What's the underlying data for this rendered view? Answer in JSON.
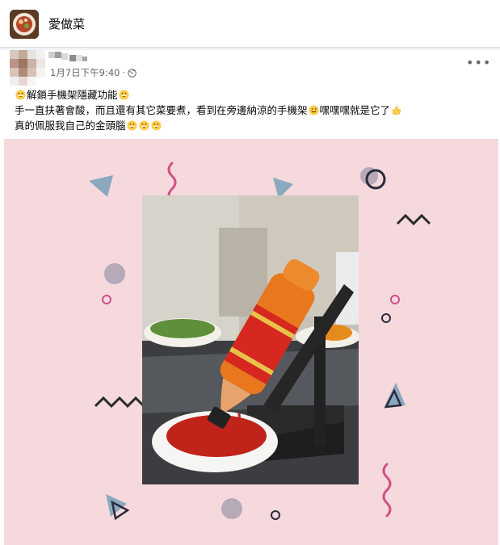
{
  "group": {
    "name": "愛做菜",
    "avatar_icon": "food-dish-avatar-icon"
  },
  "post": {
    "timestamp": "1月7日下午9:40",
    "separator": "·",
    "privacy_icon": "globe-icon",
    "more_label": "•••",
    "text": {
      "line1": "解鎖手機架隱藏功能",
      "line2_a": "手一直扶著會酸，而且還有其它菜要煮，看到在旁邊納涼的手機架",
      "line2_b": "嘿嘿嘿就是它了",
      "line3": "真的佩服我自己的金頭腦"
    }
  },
  "colors": {
    "page_bg": "#f0f2f5",
    "photo_bg": "#f6d9dd",
    "meta_text": "#65676b",
    "emoji_yellow": "#ffcc4d",
    "triangle_blue": "#8aa9bf",
    "zigzag_dark": "#2b2b2b",
    "squiggle_pink": "#d14f86",
    "circle_gray": "#b6a9b8"
  }
}
